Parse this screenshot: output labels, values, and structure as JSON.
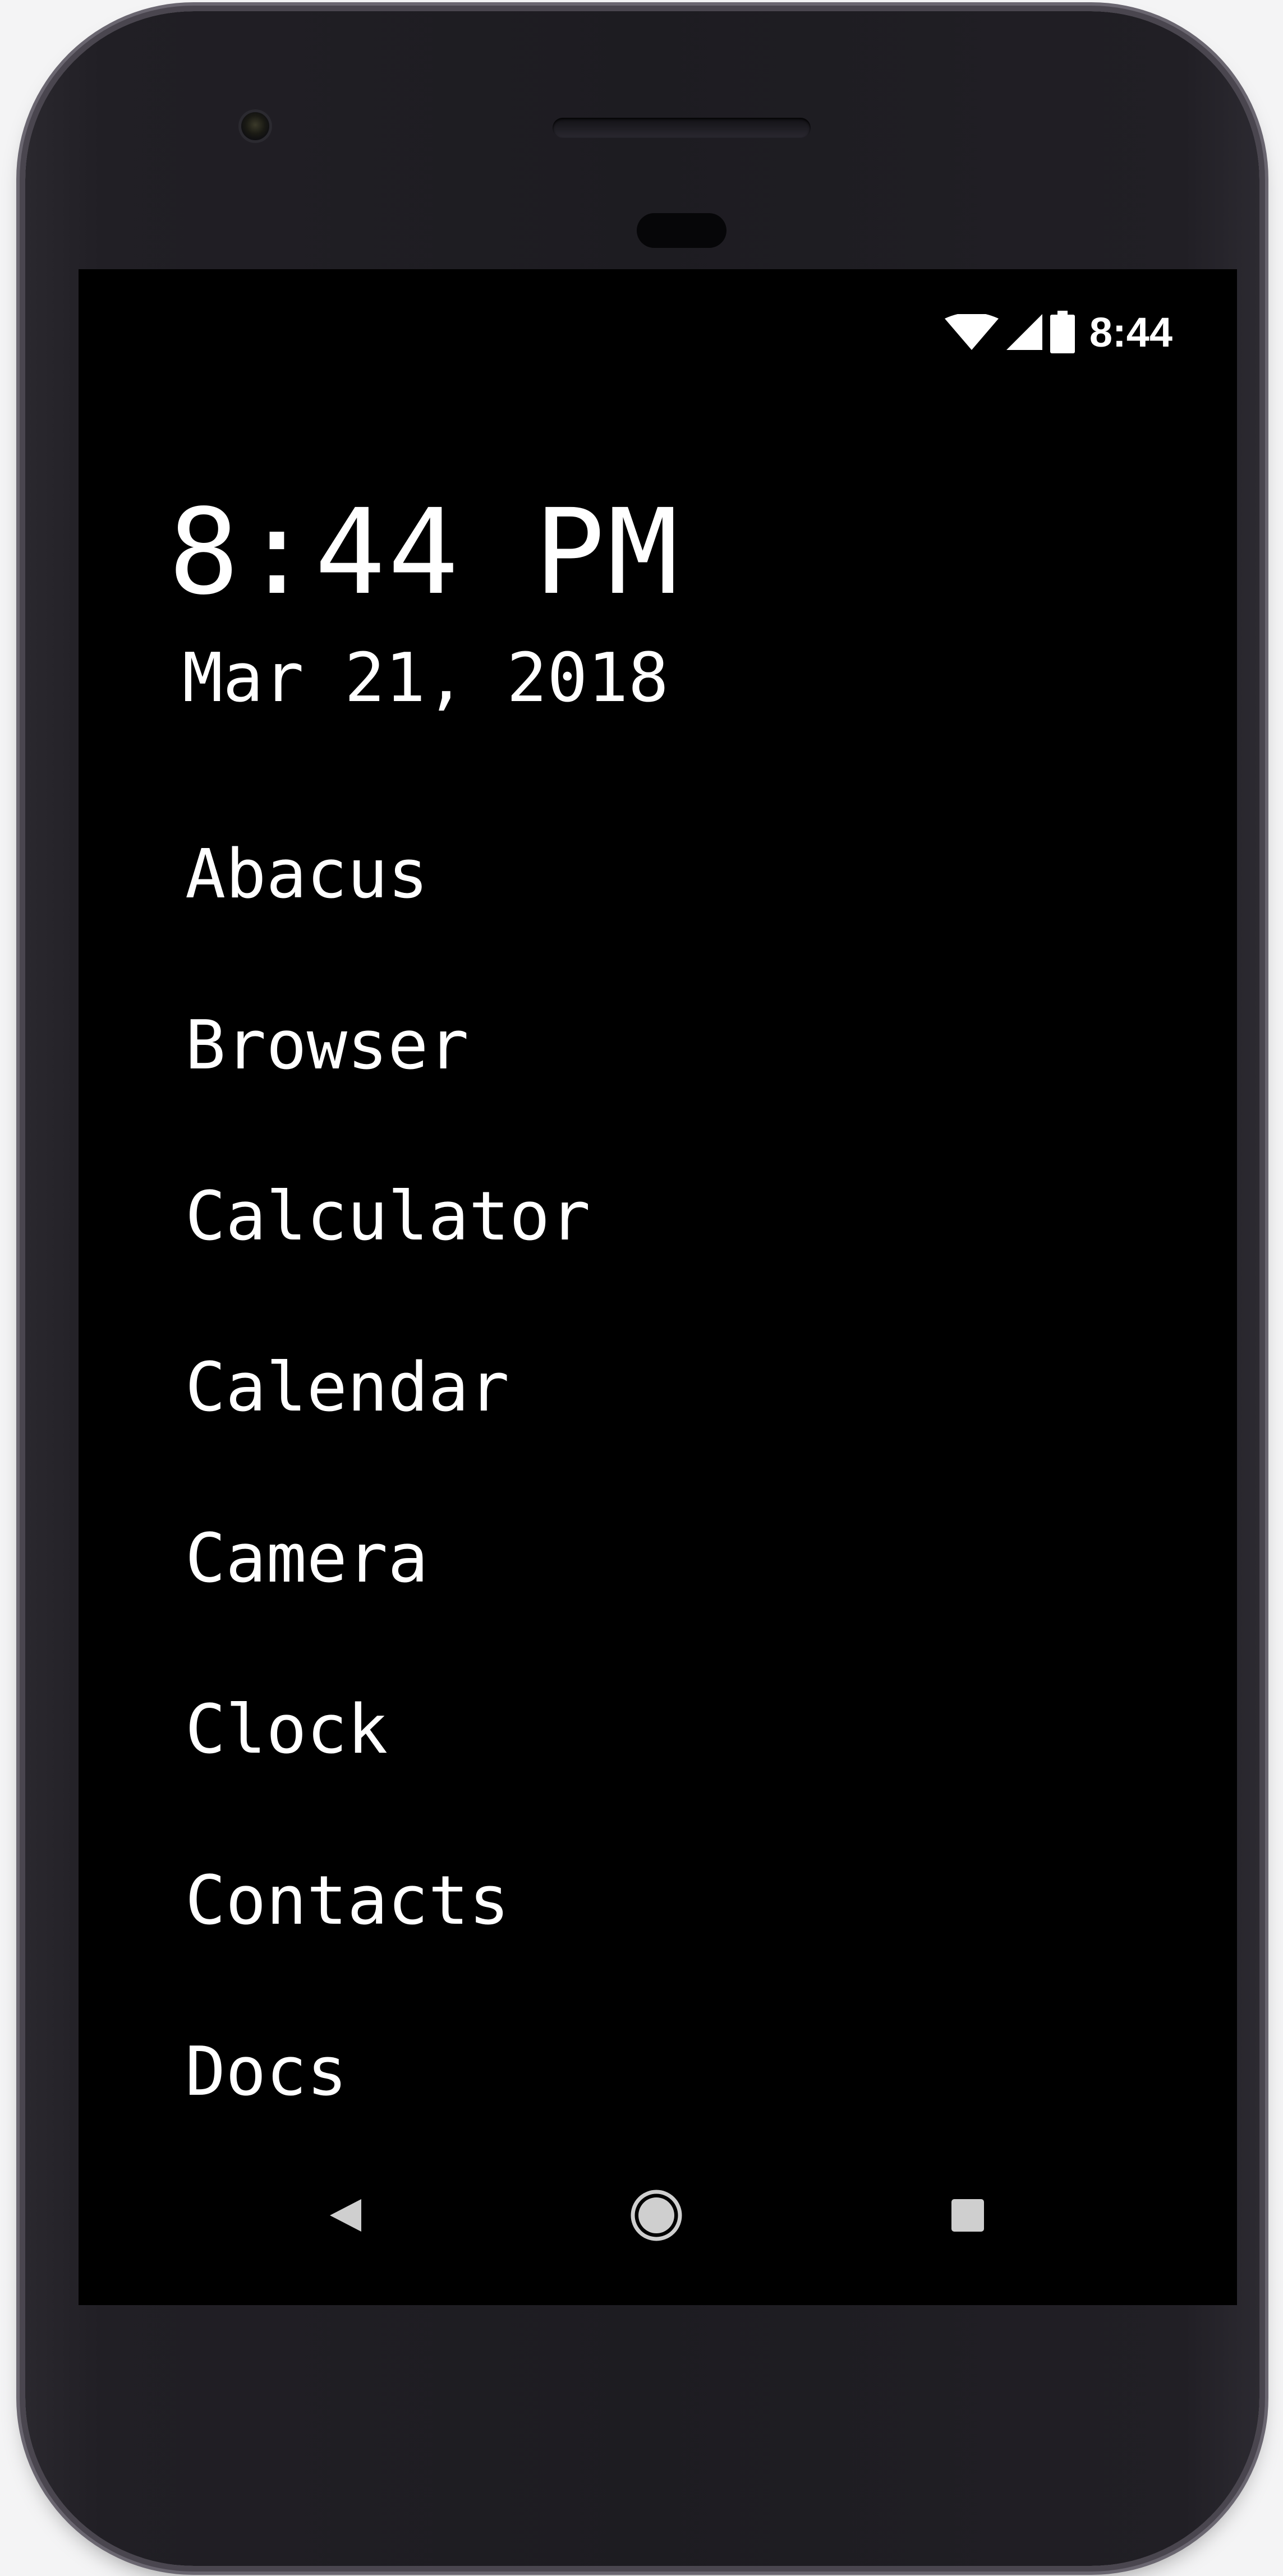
{
  "status_bar": {
    "time": "8:44",
    "icons": [
      "wifi-icon",
      "cell-signal-icon",
      "battery-icon"
    ]
  },
  "clock": {
    "time": "8:44 PM",
    "date": "Mar 21, 2018"
  },
  "apps": [
    {
      "label": "Abacus"
    },
    {
      "label": "Browser"
    },
    {
      "label": "Calculator"
    },
    {
      "label": "Calendar"
    },
    {
      "label": "Camera"
    },
    {
      "label": "Clock"
    },
    {
      "label": "Contacts"
    },
    {
      "label": "Docs"
    }
  ],
  "nav_bar": {
    "buttons": [
      "back-icon",
      "home-icon",
      "recents-icon"
    ]
  },
  "colors": {
    "screen_background": "#000000",
    "text": "#ffffff",
    "nav_icon": "#cfcfcf",
    "phone_body": "#1d1c21"
  }
}
